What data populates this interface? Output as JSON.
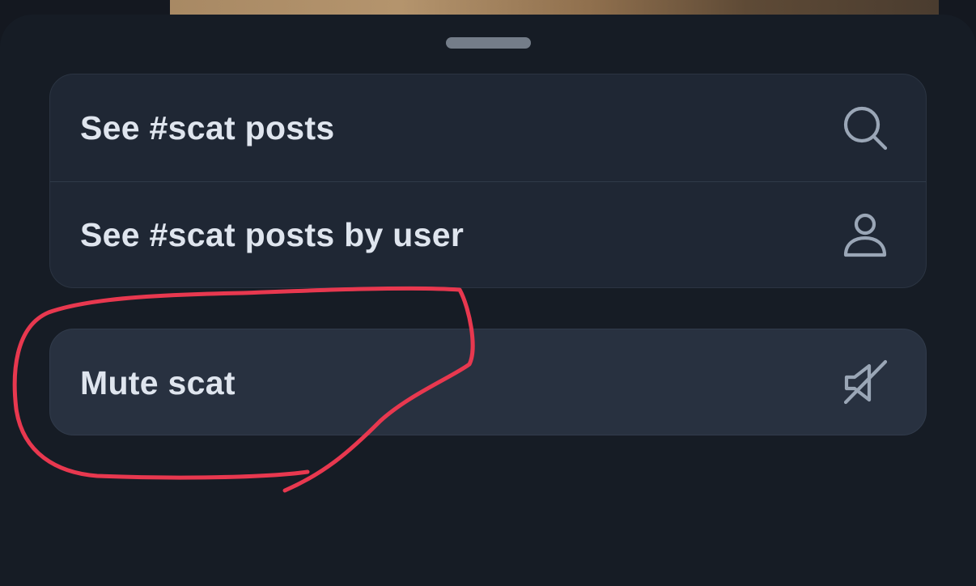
{
  "menu": {
    "items": [
      {
        "label": "See #scat posts",
        "icon": "search-icon"
      },
      {
        "label": "See #scat posts by user",
        "icon": "user-icon"
      }
    ],
    "mute": {
      "label": "Mute scat",
      "icon": "mute-icon"
    }
  },
  "colors": {
    "sheet_background": "#161c25",
    "item_background": "#1f2734",
    "mute_background": "#283140",
    "text": "#dfe5ee",
    "icon": "#9aa6b6",
    "annotation": "#e8384f"
  }
}
